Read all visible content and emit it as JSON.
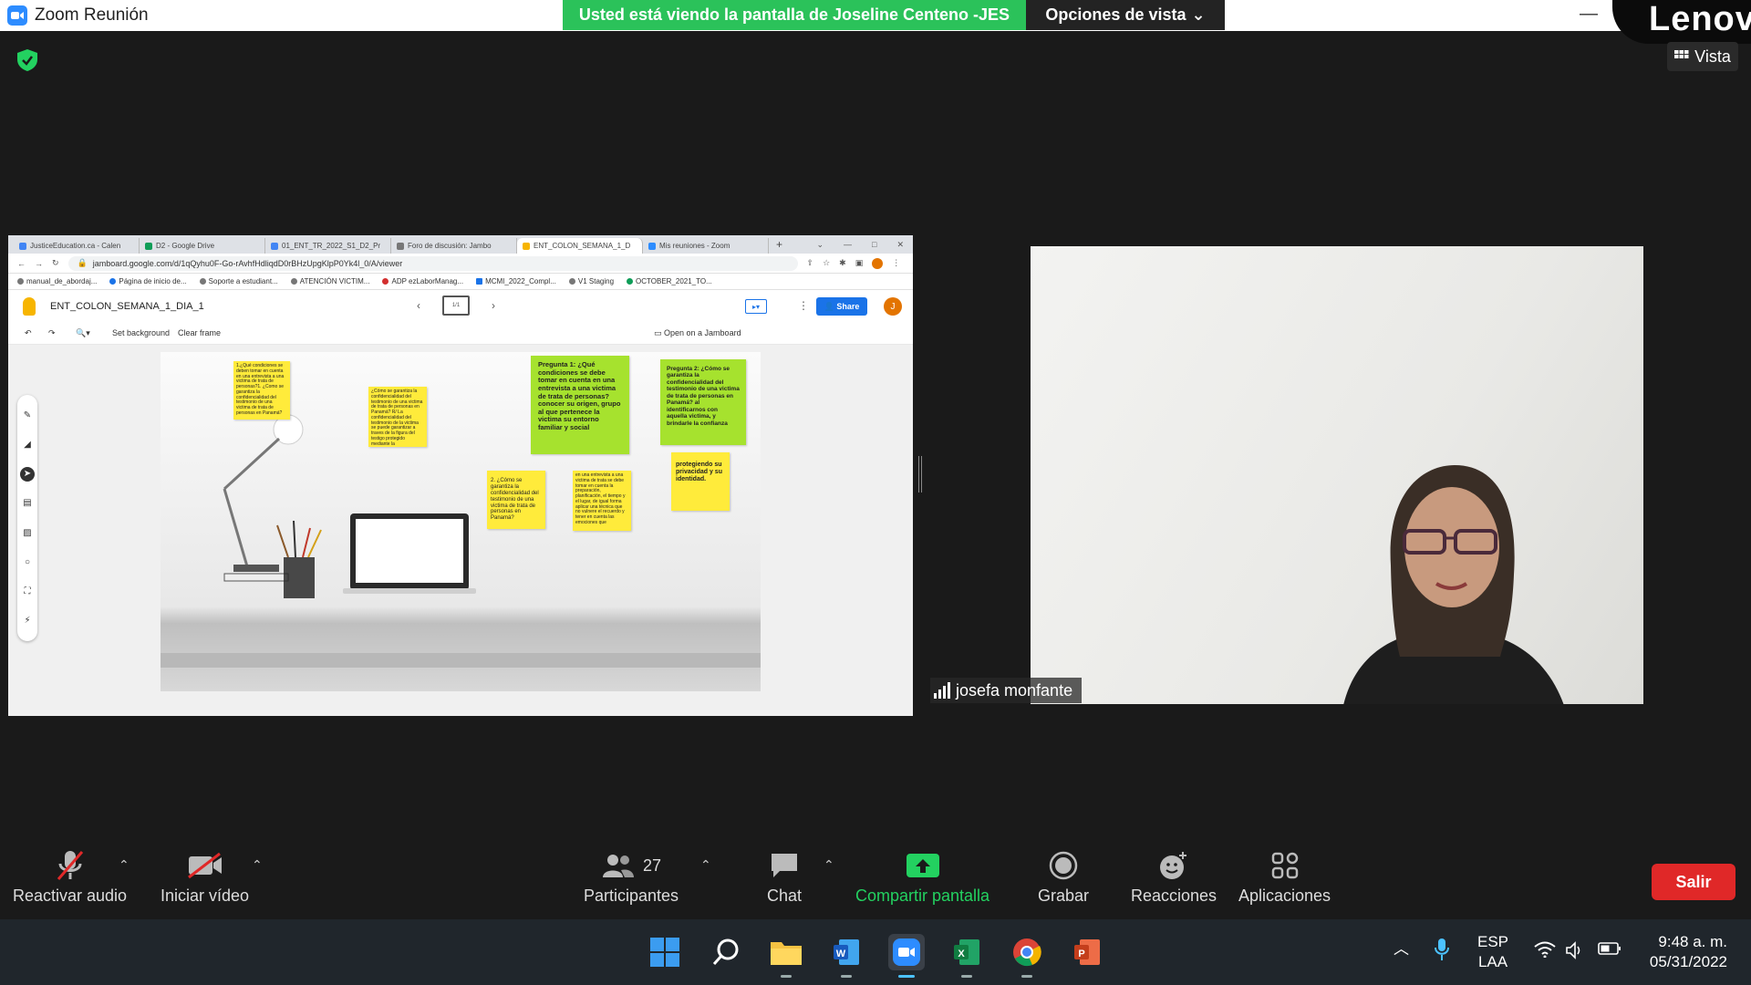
{
  "titlebar": {
    "app_title": "Zoom Reunión",
    "share_banner": "Usted está viendo la pantalla de Joseline Centeno -JES",
    "view_options": "Opciones de vista",
    "vista_button": "Vista",
    "lenovo_logo": "Lenov"
  },
  "browser": {
    "tabs": [
      {
        "label": "JusticeEducation.ca - Calen",
        "color": "#4285f4"
      },
      {
        "label": "D2 - Google Drive",
        "color": "#0f9d58"
      },
      {
        "label": "01_ENT_TR_2022_S1_D2_Pr",
        "color": "#4285f4"
      },
      {
        "label": "Foro de discusión: Jambo",
        "color": "#777777"
      },
      {
        "label": "ENT_COLON_SEMANA_1_D",
        "color": "#f7b500"
      },
      {
        "label": "Mis reuniones - Zoom",
        "color": "#2d8cff"
      }
    ],
    "url": "jamboard.google.com/d/1qQyhu0F-Go-rAvhfHdliqdD0rBHzUpgKlpP0Yk4l_0/A/viewer",
    "bookmarks": [
      "manual_de_abordaj...",
      "Página de inicio de...",
      "Soporte a estudiant...",
      "ATENCIÓN VICTIM...",
      "ADP ezLaborManag...",
      "MCMI_2022_Compl...",
      "V1 Staging",
      "OCTOBER_2021_TO..."
    ]
  },
  "jamboard": {
    "title": "ENT_COLON_SEMANA_1_DIA_1",
    "frame_indicator": "1/1",
    "share_label": "Share",
    "user_initial": "J",
    "toolbar": {
      "set_background": "Set background",
      "clear_frame": "Clear frame",
      "open_on_jamboard": "Open on a Jamboard"
    },
    "stickies": [
      {
        "text": "1.¿Qué condiciones se deben tomar en cuenta en una entrevista a una victima de trata de personas?1. ¿Como se garantiza la confidencialidad del testimonio de una victima de trata de personas en Panamá?"
      },
      {
        "text": "¿Cómo se garantiza la confidencialidad del testimonio de una victima de trata de personas en Panamá? R/ La confidencialidad del testimonio de la victima se puede garantizar a traves de la figura del testigo protegido mediante la"
      },
      {
        "text": "Pregunta 1: ¿Qué condiciones se debe tomar en cuenta en una entrevista a una victima de trata de personas?conocer su origen, grupo al que pertenece la victima su entorno familiar y social"
      },
      {
        "text": "Pregunta 2: ¿Cómo se garantiza la confidencialidad del testimonio de una victima de trata de personas en Panamá? al identificarnos con aquella victima, y brindarle la confianza"
      },
      {
        "text": "2. ¿Cómo se garantiza la confidencialidad del testimonio de una victima de trata de personas en Panamá?"
      },
      {
        "text": "en una entrevista a una victima de trata se debe tomar en cuenta la preparación, planificación, el tiempo y el lugar, de igual forma aplicar una técnica que no vulnere el recuerdo y tener en cuenta las emociones que"
      },
      {
        "text": "protegiendo su privacidad y su identidad."
      }
    ]
  },
  "video": {
    "participant_name": "josefa monfante"
  },
  "zoom_toolbar": {
    "unmute": "Reactivar audio",
    "start_video": "Iniciar vídeo",
    "participants": "Participantes",
    "participants_count": "27",
    "chat": "Chat",
    "share_screen": "Compartir pantalla",
    "record": "Grabar",
    "reactions": "Reacciones",
    "apps": "Aplicaciones",
    "leave": "Salir"
  },
  "taskbar": {
    "language_top": "ESP",
    "language_bottom": "LAA",
    "time": "9:48 a. m.",
    "date": "05/31/2022"
  },
  "colors": {
    "share_green": "#2bc25a",
    "zoom_blue": "#2d8cff",
    "leave_red": "#e02828",
    "sticky_yellow": "#ffeb3b",
    "sticky_green": "#a6e22e"
  }
}
